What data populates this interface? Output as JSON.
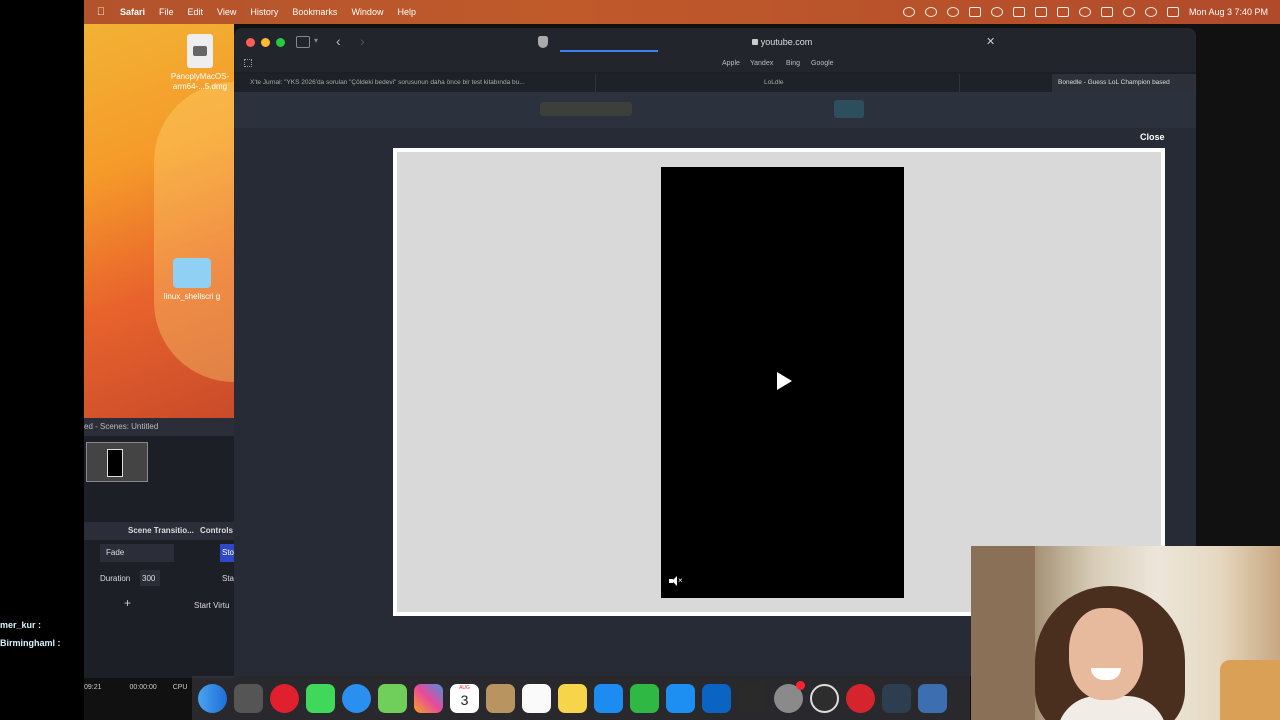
{
  "menubar": {
    "app_name": "Safari",
    "items": [
      "File",
      "Edit",
      "View",
      "History",
      "Bookmarks",
      "Window",
      "Help"
    ],
    "clock": "Mon Aug 3  7:40 PM"
  },
  "desktop": {
    "icons": [
      {
        "label": "PanoplyMacOS-arm64-...5.dmg"
      },
      {
        "label": "linux_shellscri g"
      }
    ]
  },
  "obs": {
    "title": "ed - Scenes: Untitled",
    "scene_transitions_label": "Scene Transitio...",
    "controls_label": "Controls",
    "transition_value": "Fade",
    "stop_label": "Sto",
    "duration_label": "Duration",
    "duration_value": "300",
    "start_label": "Sta",
    "start_virtual_label": "Start Virtu",
    "time_left": "09:21",
    "time_rec": "00:00:00",
    "cpu_label": "CPU"
  },
  "chat": [
    {
      "name": "mer_kur :"
    },
    {
      "name": "Birminghaml :"
    }
  ],
  "safari": {
    "address": "youtube.com",
    "favorites": [
      "Apple",
      "Yandex",
      "Bing",
      "Google"
    ],
    "tabs": [
      {
        "label": "X'te Jurnal: \"YKS 2026'da sorulan \"Çöldeki bedevi\" sorusunun daha önce bir test kitabında bu..."
      },
      {
        "label": "LoLdle"
      },
      {
        "label": "Bonedle - Guess LoL Champion based"
      }
    ]
  },
  "overlay": {
    "close_label": "Close"
  },
  "dock": {
    "calendar_day": "3",
    "apps": [
      "finder-icon",
      "launchpad-icon",
      "opera-icon",
      "messages-icon",
      "safari-icon",
      "maps-icon",
      "photos-icon",
      "calendar-icon",
      "contacts-icon",
      "reminders-icon",
      "notes-icon",
      "keynote-icon",
      "numbers-icon",
      "app-store-icon",
      "outlook-icon",
      "terminal-icon",
      "system-settings-icon",
      "obs-icon",
      "cookie-icon",
      "dictionary-icon",
      "preview-icon"
    ]
  }
}
